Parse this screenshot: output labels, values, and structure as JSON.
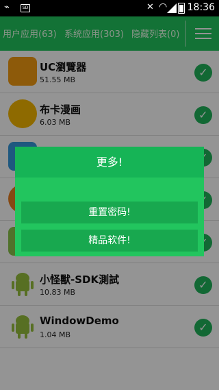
{
  "statusbar": {
    "time": "18:36",
    "sd_label": "SD"
  },
  "appbar": {
    "tabs": [
      {
        "label": "用户应用(63)"
      },
      {
        "label": "系统应用(303)"
      },
      {
        "label": "隐藏列表(0)"
      }
    ]
  },
  "apps": [
    {
      "name": "UC瀏覽器",
      "size": "51.55 MB",
      "icon": "uc-browser-icon",
      "color": "#f39c12"
    },
    {
      "name": "布卡漫画",
      "size": "6.03 MB",
      "icon": "buka-manga-icon",
      "color": "#f5b700"
    },
    {
      "name": "",
      "size": "",
      "icon": "app-icon",
      "color": "#3498db"
    },
    {
      "name": "",
      "size": "",
      "icon": "app-icon",
      "color": "#e67e22"
    },
    {
      "name": "",
      "size": "",
      "icon": "app-icon",
      "color": "#8bc34a"
    },
    {
      "name": "小怪獸-SDK測試",
      "size": "10.83 MB",
      "icon": "android-icon",
      "color": "#97c03d"
    },
    {
      "name": "WindowDemo",
      "size": "1.04 MB",
      "icon": "android-icon",
      "color": "#97c03d"
    }
  ],
  "dialog": {
    "title": "更多!",
    "reset_password": "重置密码!",
    "featured_software": "精品软件!"
  }
}
